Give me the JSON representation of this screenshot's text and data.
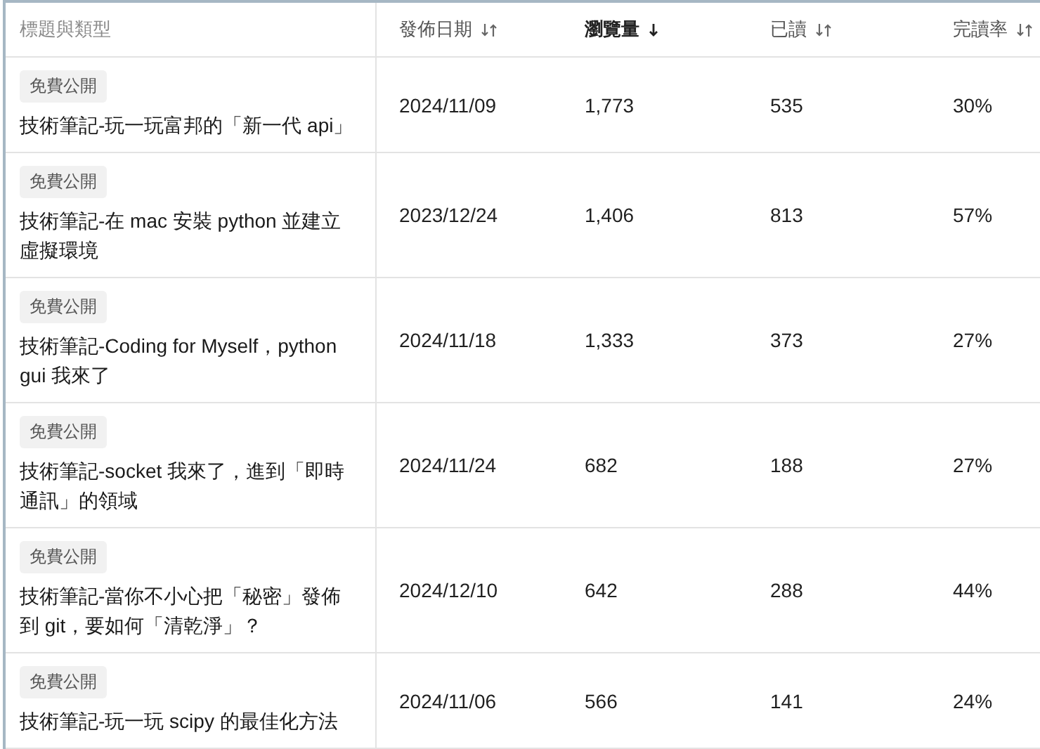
{
  "table": {
    "columns": [
      {
        "label": "標題與類型",
        "sorted": false,
        "sortable": false
      },
      {
        "label": "發佈日期",
        "sorted": false,
        "sortable": true
      },
      {
        "label": "瀏覽量",
        "sorted": true,
        "sortable": true
      },
      {
        "label": "已讀",
        "sorted": false,
        "sortable": true
      },
      {
        "label": "完讀率",
        "sorted": false,
        "sortable": true
      }
    ],
    "rows": [
      {
        "tag": "免費公開",
        "title": "技術筆記-玩一玩富邦的「新一代 api」",
        "date": "2024/11/09",
        "views": "1,773",
        "read": "535",
        "rate": "30%"
      },
      {
        "tag": "免費公開",
        "title": "技術筆記-在 mac 安裝 python 並建立虛擬環境",
        "date": "2023/12/24",
        "views": "1,406",
        "read": "813",
        "rate": "57%"
      },
      {
        "tag": "免費公開",
        "title": "技術筆記-Coding for Myself，python gui 我來了",
        "date": "2024/11/18",
        "views": "1,333",
        "read": "373",
        "rate": "27%"
      },
      {
        "tag": "免費公開",
        "title": "技術筆記-socket 我來了，進到「即時通訊」的領域",
        "date": "2024/11/24",
        "views": "682",
        "read": "188",
        "rate": "27%"
      },
      {
        "tag": "免費公開",
        "title": "技術筆記-當你不小心把「秘密」發佈到 git，要如何「清乾淨」？",
        "date": "2024/12/10",
        "views": "642",
        "read": "288",
        "rate": "44%"
      },
      {
        "tag": "免費公開",
        "title": "技術筆記-玩一玩 scipy 的最佳化方法",
        "date": "2024/11/06",
        "views": "566",
        "read": "141",
        "rate": "24%"
      }
    ]
  }
}
